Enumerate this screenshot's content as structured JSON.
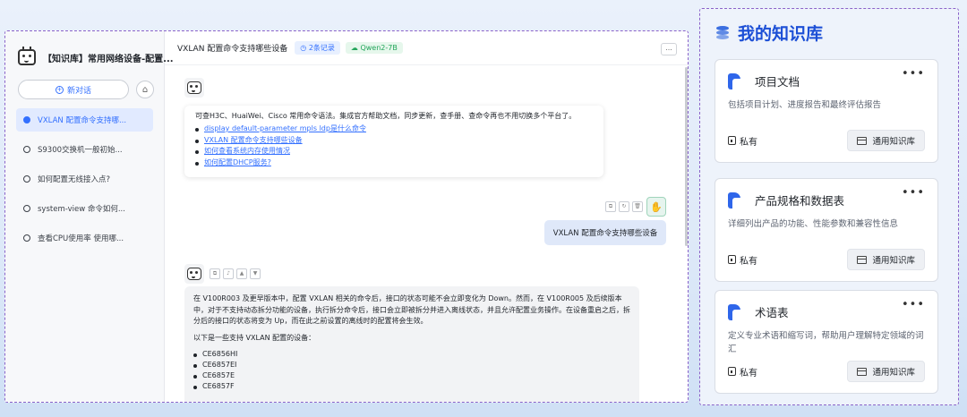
{
  "sidebar": {
    "kb_title": "【知识库】常用网络设备-配置...",
    "new_chat_label": "新对话",
    "history": [
      {
        "label": "VXLAN 配置命令支持哪...",
        "active": true
      },
      {
        "label": "S9300交换机一般初始...",
        "active": false
      },
      {
        "label": "如何配置无线接入点?",
        "active": false
      },
      {
        "label": "system-view 命令如何...",
        "active": false
      },
      {
        "label": "查看CPU使用率 使用哪...",
        "active": false
      }
    ]
  },
  "topbar": {
    "title": "VXLAN 配置命令支持哪些设备",
    "records_tag": "2条记录",
    "model_tag": "Qwen2-7B",
    "more_label": "..."
  },
  "intro": {
    "text": "可查H3C、HuaiWei、Cisco 常用命令语法。集成官方帮助文档，同步更新，查手册、查命令再也不用切换多个平台了。",
    "links": [
      "display default-parameter mpls ldp是什么命令",
      "VXLAN 配置命令支持哪些设备",
      "如何查看系统内存使用情况",
      "如何配置DHCP服务?"
    ]
  },
  "user_message": "VXLAN 配置命令支持哪些设备",
  "answer": {
    "paragraph": "在 V100R003 及更早版本中，配置 VXLAN 相关的命令后，接口的状态可能不会立即变化为 Down。然而，在 V100R005 及后续版本中，对于不支持动态拆分功能的设备，执行拆分命令后，接口会立即被拆分并进入离线状态，并且允许配置业务操作。在设备重启之后，拆分后的接口的状态将变为 Up，而在此之前设置的离线时的配置将会生效。",
    "list_intro": "以下是一些支持 VXLAN 配置的设备：",
    "devices": [
      "CE6856HI",
      "CE6857EI",
      "CE6857E",
      "CE6857F"
    ]
  },
  "panel": {
    "title": "我的知识库",
    "accent": "#1c4fd6",
    "cards": [
      {
        "name": "项目文档",
        "desc": "包括项目计划、进度报告和最终评估报告",
        "privacy": "私有",
        "button": "通用知识库"
      },
      {
        "name": "产品规格和数据表",
        "desc": "详细列出产品的功能、性能参数和兼容性信息",
        "privacy": "私有",
        "button": "通用知识库"
      },
      {
        "name": "术语表",
        "desc": "定义专业术语和缩写词，帮助用户理解特定领域的词汇",
        "privacy": "私有",
        "button": "通用知识库"
      }
    ]
  }
}
